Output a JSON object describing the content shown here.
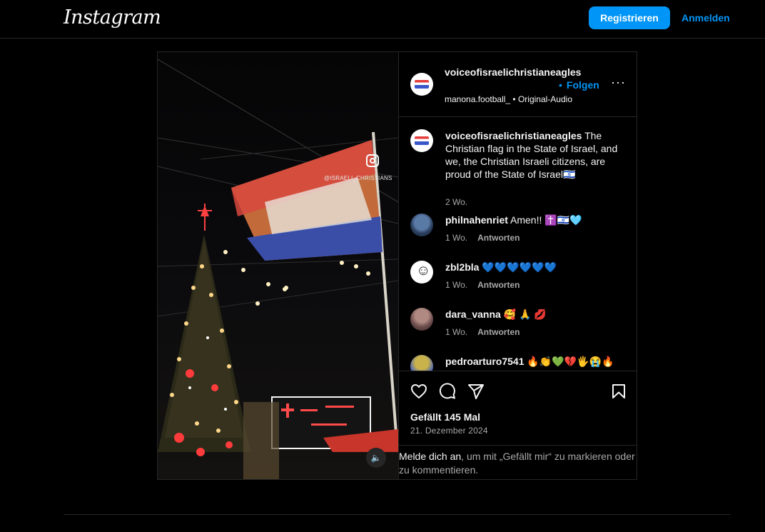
{
  "topbar": {
    "logo": "Instagram",
    "register_label": "Registrieren",
    "login_label": "Anmelden"
  },
  "media": {
    "watermark_text": "@ISRAELI_CHRISTIANS",
    "sound_icon": "speaker-icon"
  },
  "header": {
    "username": "voiceofisraelichristianeagles",
    "follow_dot": "•",
    "follow_label": "Folgen",
    "audio_user": "manona.football_",
    "audio_sep": " • ",
    "audio_label": "Original-Audio",
    "more_icon": "···"
  },
  "caption": {
    "username": "voiceofisraelichristianeagles",
    "text": " The Christian flag in the State of Israel, and we, the Christian Israeli citizens, are proud of the State of Israel🇮🇱",
    "time": "2 Wo."
  },
  "comments": [
    {
      "username": "philnahenriet",
      "text": " Amen!! ✝️🇮🇱🩵",
      "time": "1 Wo.",
      "reply": "Antworten"
    },
    {
      "username": "zbl2bla",
      "text": " 💙💙💙💙💙💙",
      "time": "1 Wo.",
      "reply": "Antworten"
    },
    {
      "username": "dara_vanna",
      "text": " 🥰 🙏 💋",
      "time": "1 Wo.",
      "reply": "Antworten"
    },
    {
      "username": "pedroarturo7541",
      "text": " 🔥👏💚💔🖐😭🔥",
      "time": "",
      "reply": ""
    }
  ],
  "actions": {
    "likes": "Gefällt 145 Mal",
    "date": "21. Dezember 2024"
  },
  "login_prompt": {
    "link": "Melde dich an",
    "rest": ", um mit „Gefällt mir“ zu markieren oder zu kommentieren."
  }
}
